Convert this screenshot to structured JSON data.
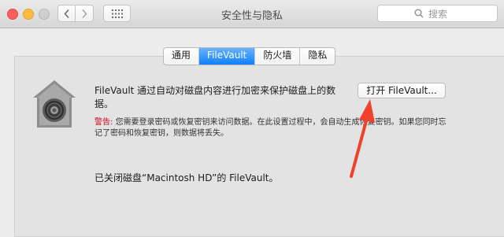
{
  "window": {
    "title": "安全性与隐私",
    "search": {
      "placeholder": "搜索",
      "value": ""
    }
  },
  "tabs": [
    {
      "label": "通用",
      "active": false
    },
    {
      "label": "FileVault",
      "active": true
    },
    {
      "label": "防火墙",
      "active": false
    },
    {
      "label": "隐私",
      "active": false
    }
  ],
  "filevault": {
    "description": "FileVault 通过自动对磁盘内容进行加密来保护磁盘上的数据。",
    "warning_label": "警告:",
    "warning_text": "您需要登录密码或恢复密钥来访问数据。在此设置过程中，会自动生成恢复密钥。如果您同时忘记了密码和恢复密钥，则数据将丢失。",
    "open_button": "打开 FileVault...",
    "status": "已关闭磁盘“Macintosh HD”的 FileVault。"
  },
  "colors": {
    "accent": "#1a87ff",
    "warning": "#d0021b",
    "annotation_arrow": "#f0412c"
  },
  "icons": [
    "back-chevron-icon",
    "forward-chevron-icon",
    "grid-icon",
    "search-icon",
    "filevault-house-lock-icon"
  ]
}
